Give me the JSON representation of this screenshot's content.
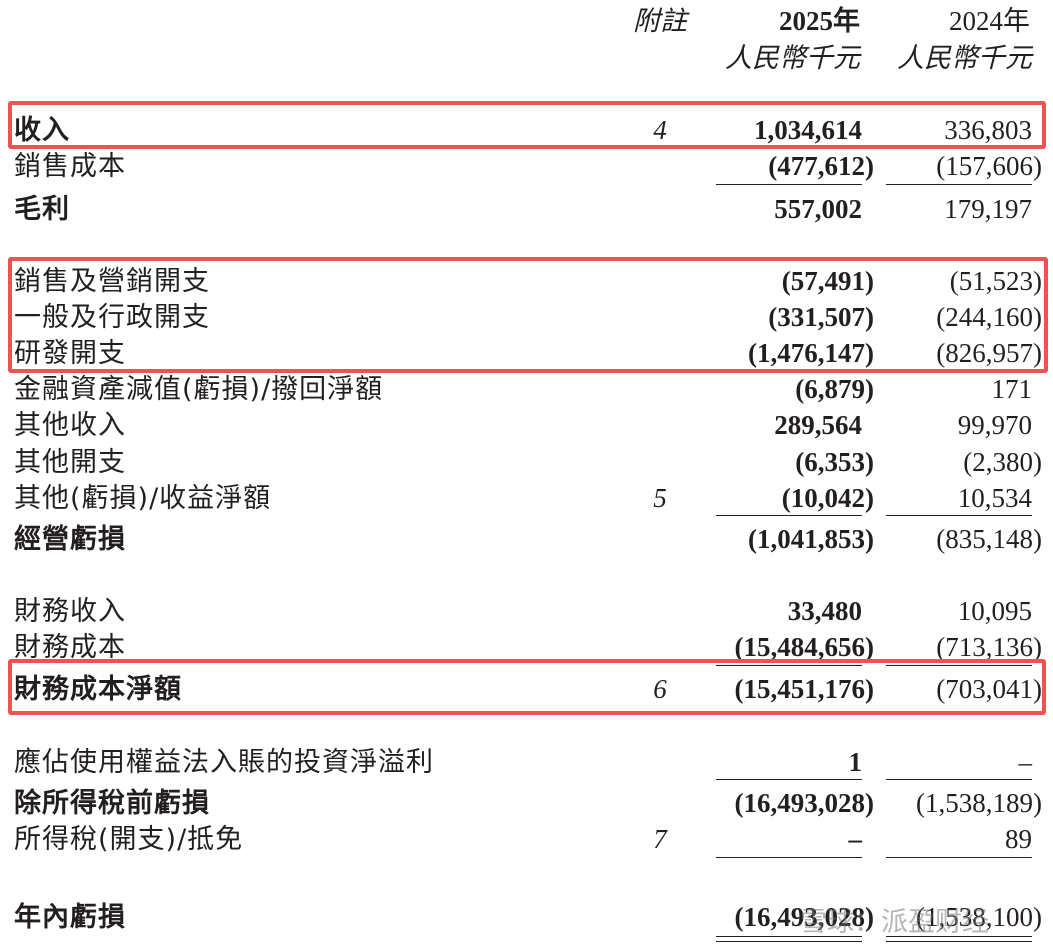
{
  "header": {
    "note_label": "附註",
    "year_2025": "2025年",
    "unit_2025": "人民幣千元",
    "year_2024": "2024年",
    "unit_2024": "人民幣千元"
  },
  "rows": [
    {
      "label": "收入",
      "bold": true,
      "note": "4",
      "y2025": "1,034,614",
      "y2024": "336,803"
    },
    {
      "label": "銷售成本",
      "bold": false,
      "note": "",
      "y2025": "(477,612)",
      "y2024": "(157,606)"
    },
    {
      "label": "毛利",
      "bold": true,
      "note": "",
      "y2025": "557,002",
      "y2024": "179,197"
    },
    {
      "label": "銷售及營銷開支",
      "bold": false,
      "note": "",
      "y2025": "(57,491)",
      "y2024": "(51,523)"
    },
    {
      "label": "一般及行政開支",
      "bold": false,
      "note": "",
      "y2025": "(331,507)",
      "y2024": "(244,160)"
    },
    {
      "label": "研發開支",
      "bold": false,
      "note": "",
      "y2025": "(1,476,147)",
      "y2024": "(826,957)"
    },
    {
      "label": "金融資產減值(虧損)/撥回淨額",
      "bold": false,
      "note": "",
      "y2025": "(6,879)",
      "y2024": "171"
    },
    {
      "label": "其他收入",
      "bold": false,
      "note": "",
      "y2025": "289,564",
      "y2024": "99,970"
    },
    {
      "label": "其他開支",
      "bold": false,
      "note": "",
      "y2025": "(6,353)",
      "y2024": "(2,380)"
    },
    {
      "label": "其他(虧損)/收益淨額",
      "bold": false,
      "note": "5",
      "y2025": "(10,042)",
      "y2024": "10,534"
    },
    {
      "label": "經營虧損",
      "bold": true,
      "note": "",
      "y2025": "(1,041,853)",
      "y2024": "(835,148)"
    },
    {
      "label": "財務收入",
      "bold": false,
      "note": "",
      "y2025": "33,480",
      "y2024": "10,095"
    },
    {
      "label": "財務成本",
      "bold": false,
      "note": "",
      "y2025": "(15,484,656)",
      "y2024": "(713,136)"
    },
    {
      "label": "財務成本淨額",
      "bold": true,
      "note": "6",
      "y2025": "(15,451,176)",
      "y2024": "(703,041)"
    },
    {
      "label": "應佔使用權益法入賬的投資淨溢利",
      "bold": false,
      "note": "",
      "y2025": "1",
      "y2024": "–"
    },
    {
      "label": "除所得稅前虧損",
      "bold": true,
      "note": "",
      "y2025": "(16,493,028)",
      "y2024": "(1,538,189)"
    },
    {
      "label": "所得稅(開支)/抵免",
      "bold": false,
      "note": "7",
      "y2025": "–",
      "y2024": "89"
    },
    {
      "label": "年內虧損",
      "bold": true,
      "note": "",
      "y2025": "(16,493,028)",
      "y2024": "(1,538,100)"
    }
  ],
  "watermark": "雪球：派盈财经",
  "highlight_color": "#ef5350"
}
